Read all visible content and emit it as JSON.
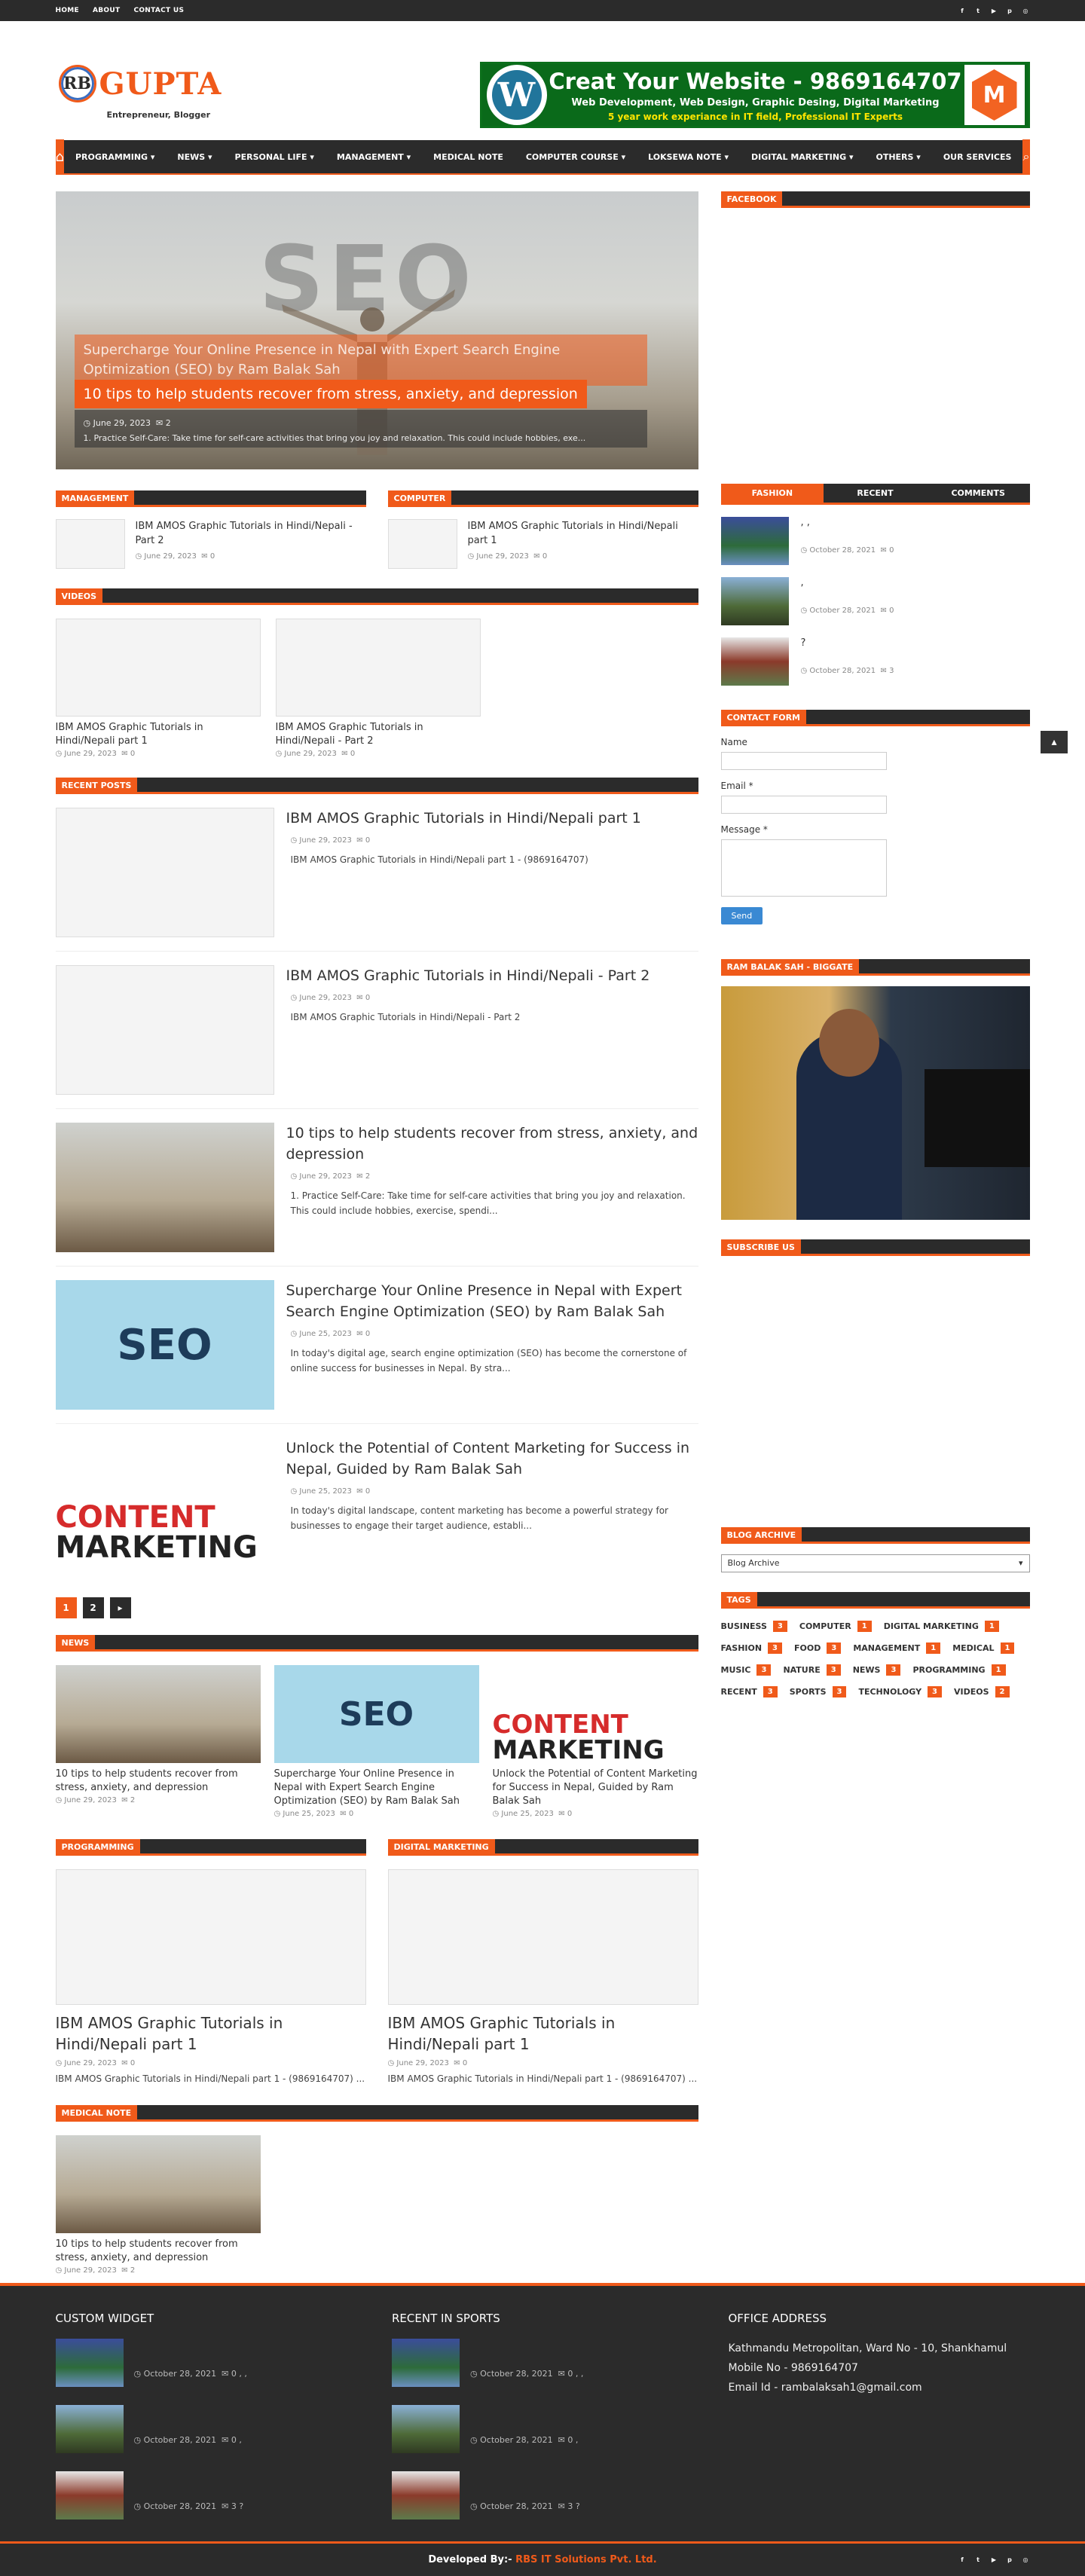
{
  "topbar": {
    "links": [
      "HOME",
      "ABOUT",
      "CONTACT US"
    ]
  },
  "logo": {
    "mark": "RB",
    "name": "GUPTA",
    "tagline": "Entrepreneur, Blogger"
  },
  "banner": {
    "title": "Creat Your Website - 9869164707",
    "line1": "Web Development, Web Design, Graphic Desing, Digital Marketing",
    "line2": "5 year work experiance in IT field, Professional IT Experts"
  },
  "nav": {
    "items": [
      "PROGRAMMING ▾",
      "NEWS ▾",
      "PERSONAL LIFE ▾",
      "MANAGEMENT ▾",
      "MEDICAL NOTE",
      "COMPUTER COURSE ▾",
      "LOKSEWA NOTE ▾",
      "DIGITAL MARKETING ▾",
      "OTHERS ▾",
      "OUR SERVICES"
    ]
  },
  "hero": {
    "bg_text": "SEO",
    "back_title": "Supercharge Your Online Presence in Nepal with Expert Search Engine Optimization (SEO) by Ram Balak Sah",
    "title": "10 tips to help students recover from stress, anxiety, and depression",
    "date": "June 29, 2023",
    "comments": "2",
    "summary": "1. Practice Self-Care: Take time for self-care activities that bring you joy and relaxation. This could include hobbies, exe..."
  },
  "management": {
    "label": "MANAGEMENT",
    "title": "IBM AMOS Graphic Tutorials in Hindi/Nepali - Part 2",
    "date": "June 29, 2023",
    "comments": "0"
  },
  "computer": {
    "label": "COMPUTER",
    "title": "IBM AMOS Graphic Tutorials in Hindi/Nepali part 1",
    "date": "June 29, 2023",
    "comments": "0"
  },
  "videos": {
    "label": "VIDEOS",
    "items": [
      {
        "title": "IBM AMOS Graphic Tutorials in Hindi/Nepali part 1",
        "date": "June 29, 2023",
        "comments": "0"
      },
      {
        "title": "IBM AMOS Graphic Tutorials in Hindi/Nepali - Part 2",
        "date": "June 29, 2023",
        "comments": "0"
      }
    ]
  },
  "recent": {
    "label": "RECENT POSTS",
    "items": [
      {
        "title": "IBM AMOS Graphic Tutorials in Hindi/Nepali part 1",
        "date": "June 29, 2023",
        "comments": "0",
        "summary": "IBM AMOS Graphic Tutorials in Hindi/Nepali part 1 - (9869164707)"
      },
      {
        "title": "IBM AMOS Graphic Tutorials in Hindi/Nepali - Part 2",
        "date": "June 29, 2023",
        "comments": "0",
        "summary": "IBM AMOS Graphic Tutorials in Hindi/Nepali - Part 2"
      },
      {
        "title": "10 tips to help students recover from stress, anxiety, and depression",
        "date": "June 29, 2023",
        "comments": "2",
        "summary": "1. Practice Self-Care: Take time for self-care activities that bring you joy and relaxation. This could include hobbies, exercise, spendi..."
      },
      {
        "title": "Supercharge Your Online Presence in Nepal with Expert Search Engine Optimization (SEO) by Ram Balak Sah",
        "date": "June 25, 2023",
        "comments": "0",
        "summary": "In today's digital age, search engine optimization (SEO) has become the cornerstone of online success for businesses in Nepal. By stra..."
      },
      {
        "title": "Unlock the Potential of Content Marketing for Success in Nepal, Guided by Ram Balak Sah",
        "date": "June 25, 2023",
        "comments": "0",
        "summary": "In today's digital landscape, content marketing has become a powerful strategy for businesses to engage their target audience, establi..."
      }
    ]
  },
  "pager": [
    "1",
    "2",
    "▸"
  ],
  "news": {
    "label": "NEWS",
    "items": [
      {
        "title": "10 tips to help students recover from stress, anxiety, and depression",
        "date": "June 29, 2023",
        "comments": "2"
      },
      {
        "title": "Supercharge Your Online Presence in Nepal with Expert Search Engine Optimization (SEO) by Ram Balak Sah",
        "date": "June 25, 2023",
        "comments": "0"
      },
      {
        "title": "Unlock the Potential of Content Marketing for Success in Nepal, Guided by Ram Balak Sah",
        "date": "June 25, 2023",
        "comments": "0"
      }
    ]
  },
  "programming": {
    "label": "PROGRAMMING",
    "title": "IBM AMOS Graphic Tutorials in Hindi/Nepali part 1",
    "date": "June 29, 2023",
    "comments": "0",
    "summary": "IBM AMOS Graphic Tutorials in Hindi/Nepali part 1 - (9869164707) ..."
  },
  "digital": {
    "label": "DIGITAL MARKETING",
    "title": "IBM AMOS Graphic Tutorials in Hindi/Nepali part 1",
    "date": "June 29, 2023",
    "comments": "0",
    "summary": "IBM AMOS Graphic Tutorials in Hindi/Nepali part 1 - (9869164707) ..."
  },
  "medical": {
    "label": "MEDICAL NOTE",
    "title": "10 tips to help students recover from stress, anxiety, and depression",
    "date": "June 29, 2023",
    "comments": "2"
  },
  "sidebar": {
    "facebook": "FACEBOOK",
    "tabs": [
      "FASHION",
      "RECENT",
      "COMMENTS"
    ],
    "posts": [
      {
        "title": ",            ,",
        "date": "October 28, 2021",
        "comments": "0"
      },
      {
        "title": ",",
        "date": "October 28, 2021",
        "comments": "0"
      },
      {
        "title": "?",
        "date": "October 28, 2021",
        "comments": "3"
      }
    ],
    "contact": {
      "label": "CONTACT FORM",
      "name": "Name",
      "email": "Email *",
      "message": "Message *",
      "send": "Send"
    },
    "profile": "RAM BALAK SAH - BIGGATE",
    "subscribe": "SUBSCRIBE US",
    "archive": {
      "label": "BLOG ARCHIVE",
      "select": "Blog Archive"
    },
    "tags_label": "TAGS",
    "tags": [
      {
        "name": "BUSINESS",
        "count": "3"
      },
      {
        "name": "COMPUTER",
        "count": "1"
      },
      {
        "name": "DIGITAL MARKETING",
        "count": "1"
      },
      {
        "name": "FASHION",
        "count": "3"
      },
      {
        "name": "FOOD",
        "count": "3"
      },
      {
        "name": "MANAGEMENT",
        "count": "1"
      },
      {
        "name": "MEDICAL",
        "count": "1"
      },
      {
        "name": "MUSIC",
        "count": "3"
      },
      {
        "name": "NATURE",
        "count": "3"
      },
      {
        "name": "NEWS",
        "count": "3"
      },
      {
        "name": "PROGRAMMING",
        "count": "1"
      },
      {
        "name": "RECENT",
        "count": "3"
      },
      {
        "name": "SPORTS",
        "count": "3"
      },
      {
        "name": "TECHNOLOGY",
        "count": "3"
      },
      {
        "name": "VIDEOS",
        "count": "2"
      }
    ]
  },
  "footer": {
    "widget": "CUSTOM WIDGET",
    "sports": "RECENT IN SPORTS",
    "office": "OFFICE ADDRESS",
    "posts": [
      {
        "title": ",            ,",
        "date": "October 28, 2021",
        "comments": "0"
      },
      {
        "title": ",",
        "date": "October 28, 2021",
        "comments": "0"
      },
      {
        "title": "?",
        "date": "October 28, 2021",
        "comments": "3"
      }
    ],
    "address": "Kathmandu Metropolitan, Ward No - 10, Shankhamul",
    "mobile": "Mobile No - 9869164707",
    "email": "Email Id - rambalaksah1@gmail.com",
    "dev_label": "Developed By:-",
    "dev_name": "RBS IT Solutions Pvt. Ltd."
  },
  "colors": {
    "accent": "#f05a1a",
    "dark": "#2b2b2b"
  }
}
